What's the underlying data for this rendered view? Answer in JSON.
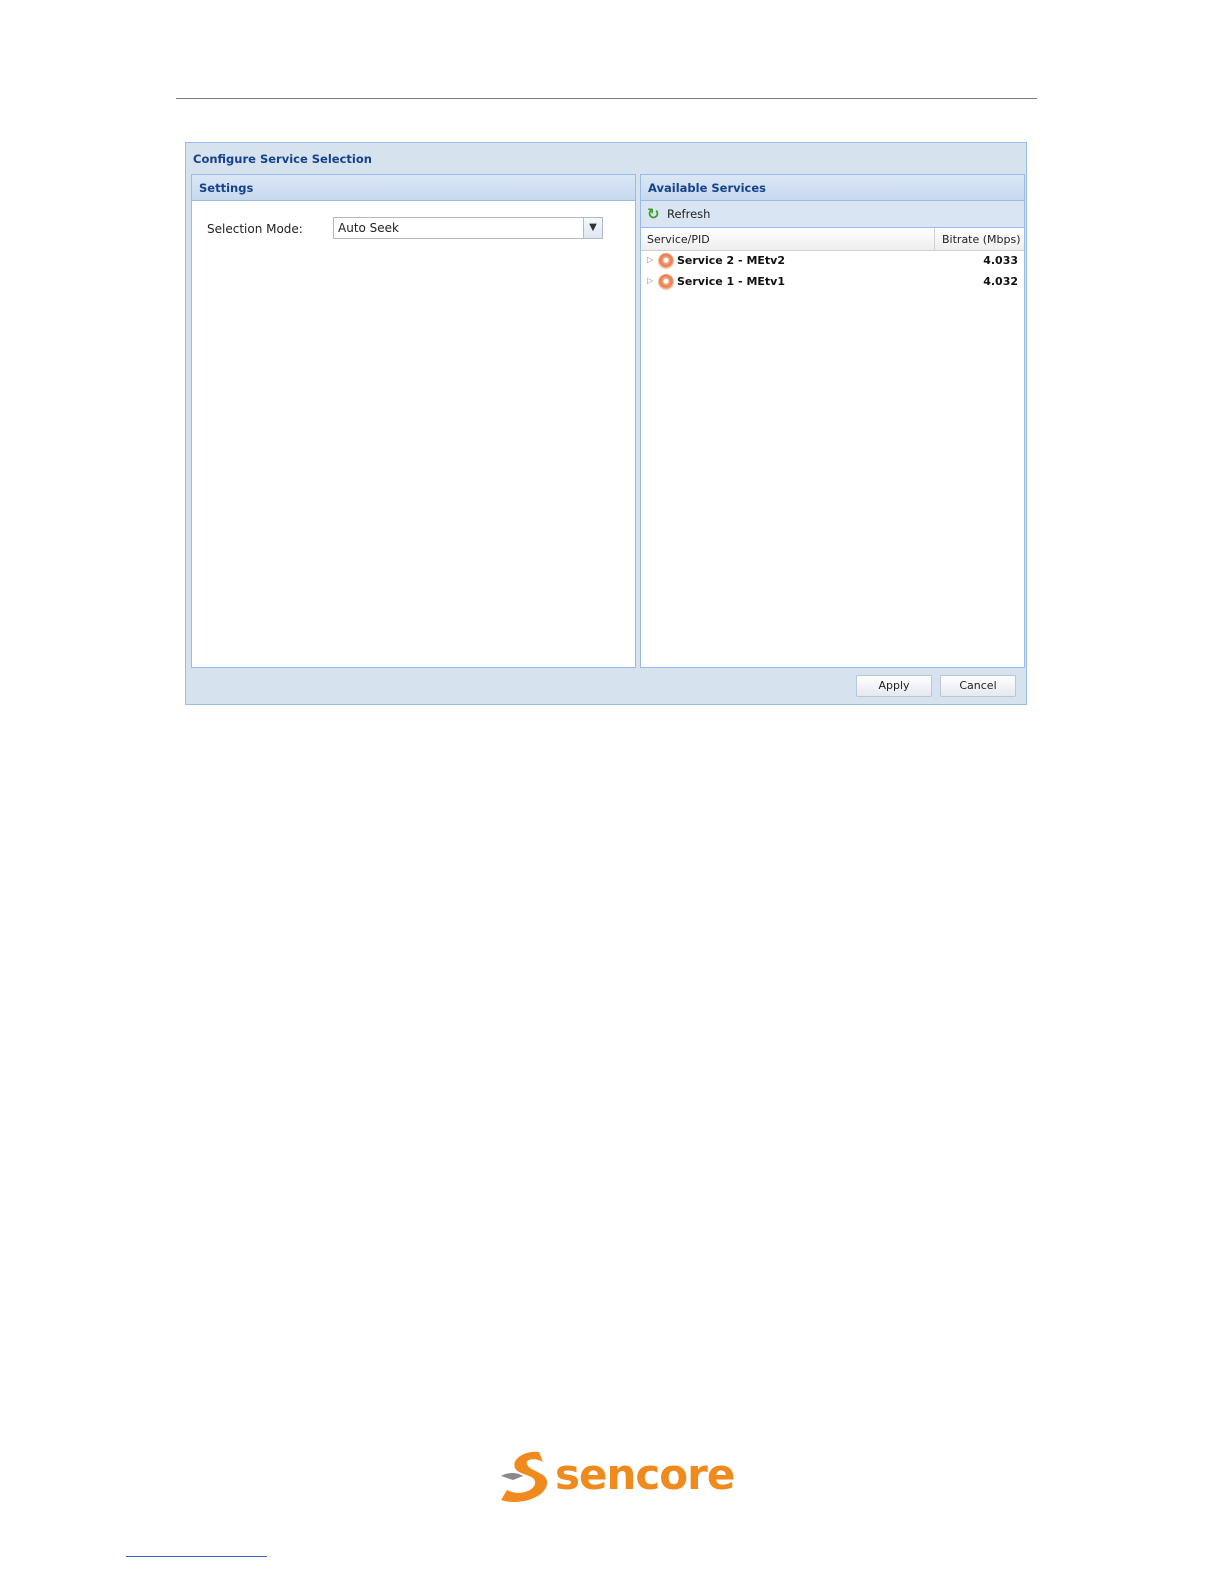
{
  "dialog": {
    "title": "Configure Service Selection",
    "settings": {
      "title": "Settings",
      "selection_mode_label": "Selection Mode:",
      "selection_mode_value": "Auto Seek"
    },
    "services": {
      "title": "Available Services",
      "refresh_label": "Refresh",
      "columns": [
        "Service/PID",
        "Bitrate (Mbps)"
      ],
      "rows": [
        {
          "name": "Service 2 - MEtv2",
          "bitrate": "4.033"
        },
        {
          "name": "Service 1 - MEtv1",
          "bitrate": "4.032"
        }
      ]
    },
    "buttons": {
      "apply": "Apply",
      "cancel": "Cancel"
    }
  },
  "footer": {
    "logo_text": "sencore",
    "logo_color": "#f08a1c"
  }
}
